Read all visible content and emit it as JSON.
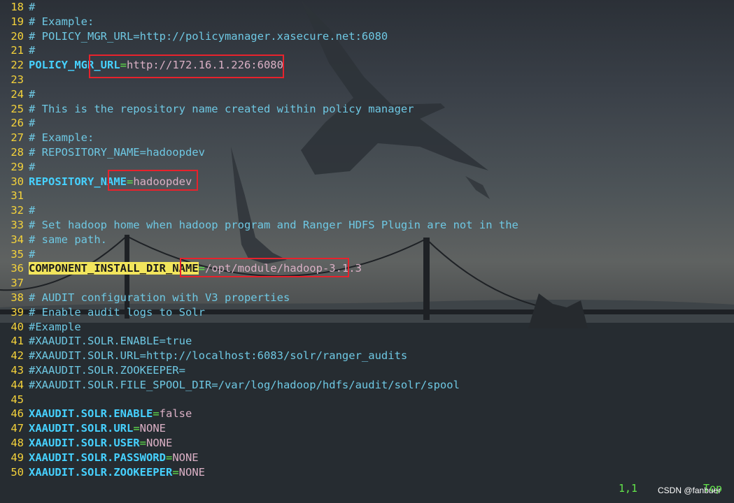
{
  "lines": [
    {
      "n": "18",
      "parts": [
        {
          "t": "#",
          "c": "cm"
        }
      ]
    },
    {
      "n": "19",
      "parts": [
        {
          "t": "# Example:",
          "c": "cm"
        }
      ]
    },
    {
      "n": "20",
      "parts": [
        {
          "t": "# POLICY_MGR_URL=http://policymanager.xasecure.net:6080",
          "c": "cm"
        }
      ]
    },
    {
      "n": "21",
      "parts": [
        {
          "t": "#",
          "c": "cm"
        }
      ]
    },
    {
      "n": "22",
      "parts": [
        {
          "t": "POLICY_MGR_URL",
          "c": "key"
        },
        {
          "t": "=",
          "c": "eq"
        },
        {
          "t": "http://172.16.1.226:6080",
          "c": "val"
        }
      ]
    },
    {
      "n": "23",
      "parts": []
    },
    {
      "n": "24",
      "parts": [
        {
          "t": "#",
          "c": "cm"
        }
      ]
    },
    {
      "n": "25",
      "parts": [
        {
          "t": "# This is the repository name created within policy manager",
          "c": "cm"
        }
      ]
    },
    {
      "n": "26",
      "parts": [
        {
          "t": "#",
          "c": "cm"
        }
      ]
    },
    {
      "n": "27",
      "parts": [
        {
          "t": "# Example:",
          "c": "cm"
        }
      ]
    },
    {
      "n": "28",
      "parts": [
        {
          "t": "# REPOSITORY_NAME=hadoopdev",
          "c": "cm"
        }
      ]
    },
    {
      "n": "29",
      "parts": [
        {
          "t": "#",
          "c": "cm"
        }
      ]
    },
    {
      "n": "30",
      "parts": [
        {
          "t": "REPOSITORY_NAME",
          "c": "key"
        },
        {
          "t": "=",
          "c": "eq"
        },
        {
          "t": "hadoopdev",
          "c": "val"
        }
      ]
    },
    {
      "n": "31",
      "parts": []
    },
    {
      "n": "32",
      "parts": [
        {
          "t": "#",
          "c": "cm"
        }
      ]
    },
    {
      "n": "33",
      "parts": [
        {
          "t": "# Set hadoop home when hadoop program and Ranger HDFS Plugin are not in the",
          "c": "cm"
        }
      ]
    },
    {
      "n": "34",
      "parts": [
        {
          "t": "# same path.",
          "c": "cm"
        }
      ]
    },
    {
      "n": "35",
      "parts": [
        {
          "t": "#",
          "c": "cm"
        }
      ]
    },
    {
      "n": "36",
      "parts": [
        {
          "t": "COMPONENT_INSTALL_DIR_NAME",
          "c": "key-hl"
        },
        {
          "t": "=",
          "c": "eq"
        },
        {
          "t": "/opt/module/hadoop-3.1.3",
          "c": "val"
        }
      ]
    },
    {
      "n": "37",
      "parts": []
    },
    {
      "n": "38",
      "parts": [
        {
          "t": "# AUDIT configuration with V3 properties",
          "c": "cm"
        }
      ]
    },
    {
      "n": "39",
      "parts": [
        {
          "t": "# Enable audit logs to Solr",
          "c": "cm"
        }
      ]
    },
    {
      "n": "40",
      "parts": [
        {
          "t": "#Example",
          "c": "cm"
        }
      ]
    },
    {
      "n": "41",
      "parts": [
        {
          "t": "#XAAUDIT.SOLR.ENABLE=true",
          "c": "cm"
        }
      ]
    },
    {
      "n": "42",
      "parts": [
        {
          "t": "#XAAUDIT.SOLR.URL=http://localhost:6083/solr/ranger_audits",
          "c": "cm"
        }
      ]
    },
    {
      "n": "43",
      "parts": [
        {
          "t": "#XAAUDIT.SOLR.ZOOKEEPER=",
          "c": "cm"
        }
      ]
    },
    {
      "n": "44",
      "parts": [
        {
          "t": "#XAAUDIT.SOLR.FILE_SPOOL_DIR=/var/log/hadoop/hdfs/audit/solr/spool",
          "c": "cm"
        }
      ]
    },
    {
      "n": "45",
      "parts": []
    },
    {
      "n": "46",
      "parts": [
        {
          "t": "XAAUDIT.SOLR.ENABLE",
          "c": "key"
        },
        {
          "t": "=",
          "c": "eq"
        },
        {
          "t": "false",
          "c": "val"
        }
      ]
    },
    {
      "n": "47",
      "parts": [
        {
          "t": "XAAUDIT.SOLR.URL",
          "c": "key"
        },
        {
          "t": "=",
          "c": "eq"
        },
        {
          "t": "NONE",
          "c": "val"
        }
      ]
    },
    {
      "n": "48",
      "parts": [
        {
          "t": "XAAUDIT.SOLR.USER",
          "c": "key"
        },
        {
          "t": "=",
          "c": "eq"
        },
        {
          "t": "NONE",
          "c": "val"
        }
      ]
    },
    {
      "n": "49",
      "parts": [
        {
          "t": "XAAUDIT.SOLR.PASSWORD",
          "c": "key"
        },
        {
          "t": "=",
          "c": "eq"
        },
        {
          "t": "NONE",
          "c": "val"
        }
      ]
    },
    {
      "n": "50",
      "parts": [
        {
          "t": "XAAUDIT.SOLR.ZOOKEEPER",
          "c": "key"
        },
        {
          "t": "=",
          "c": "eq"
        },
        {
          "t": "NONE",
          "c": "val"
        }
      ]
    }
  ],
  "status": {
    "position": "1,1",
    "scroll": "Top"
  },
  "watermark": "CSDN @fanbuer"
}
